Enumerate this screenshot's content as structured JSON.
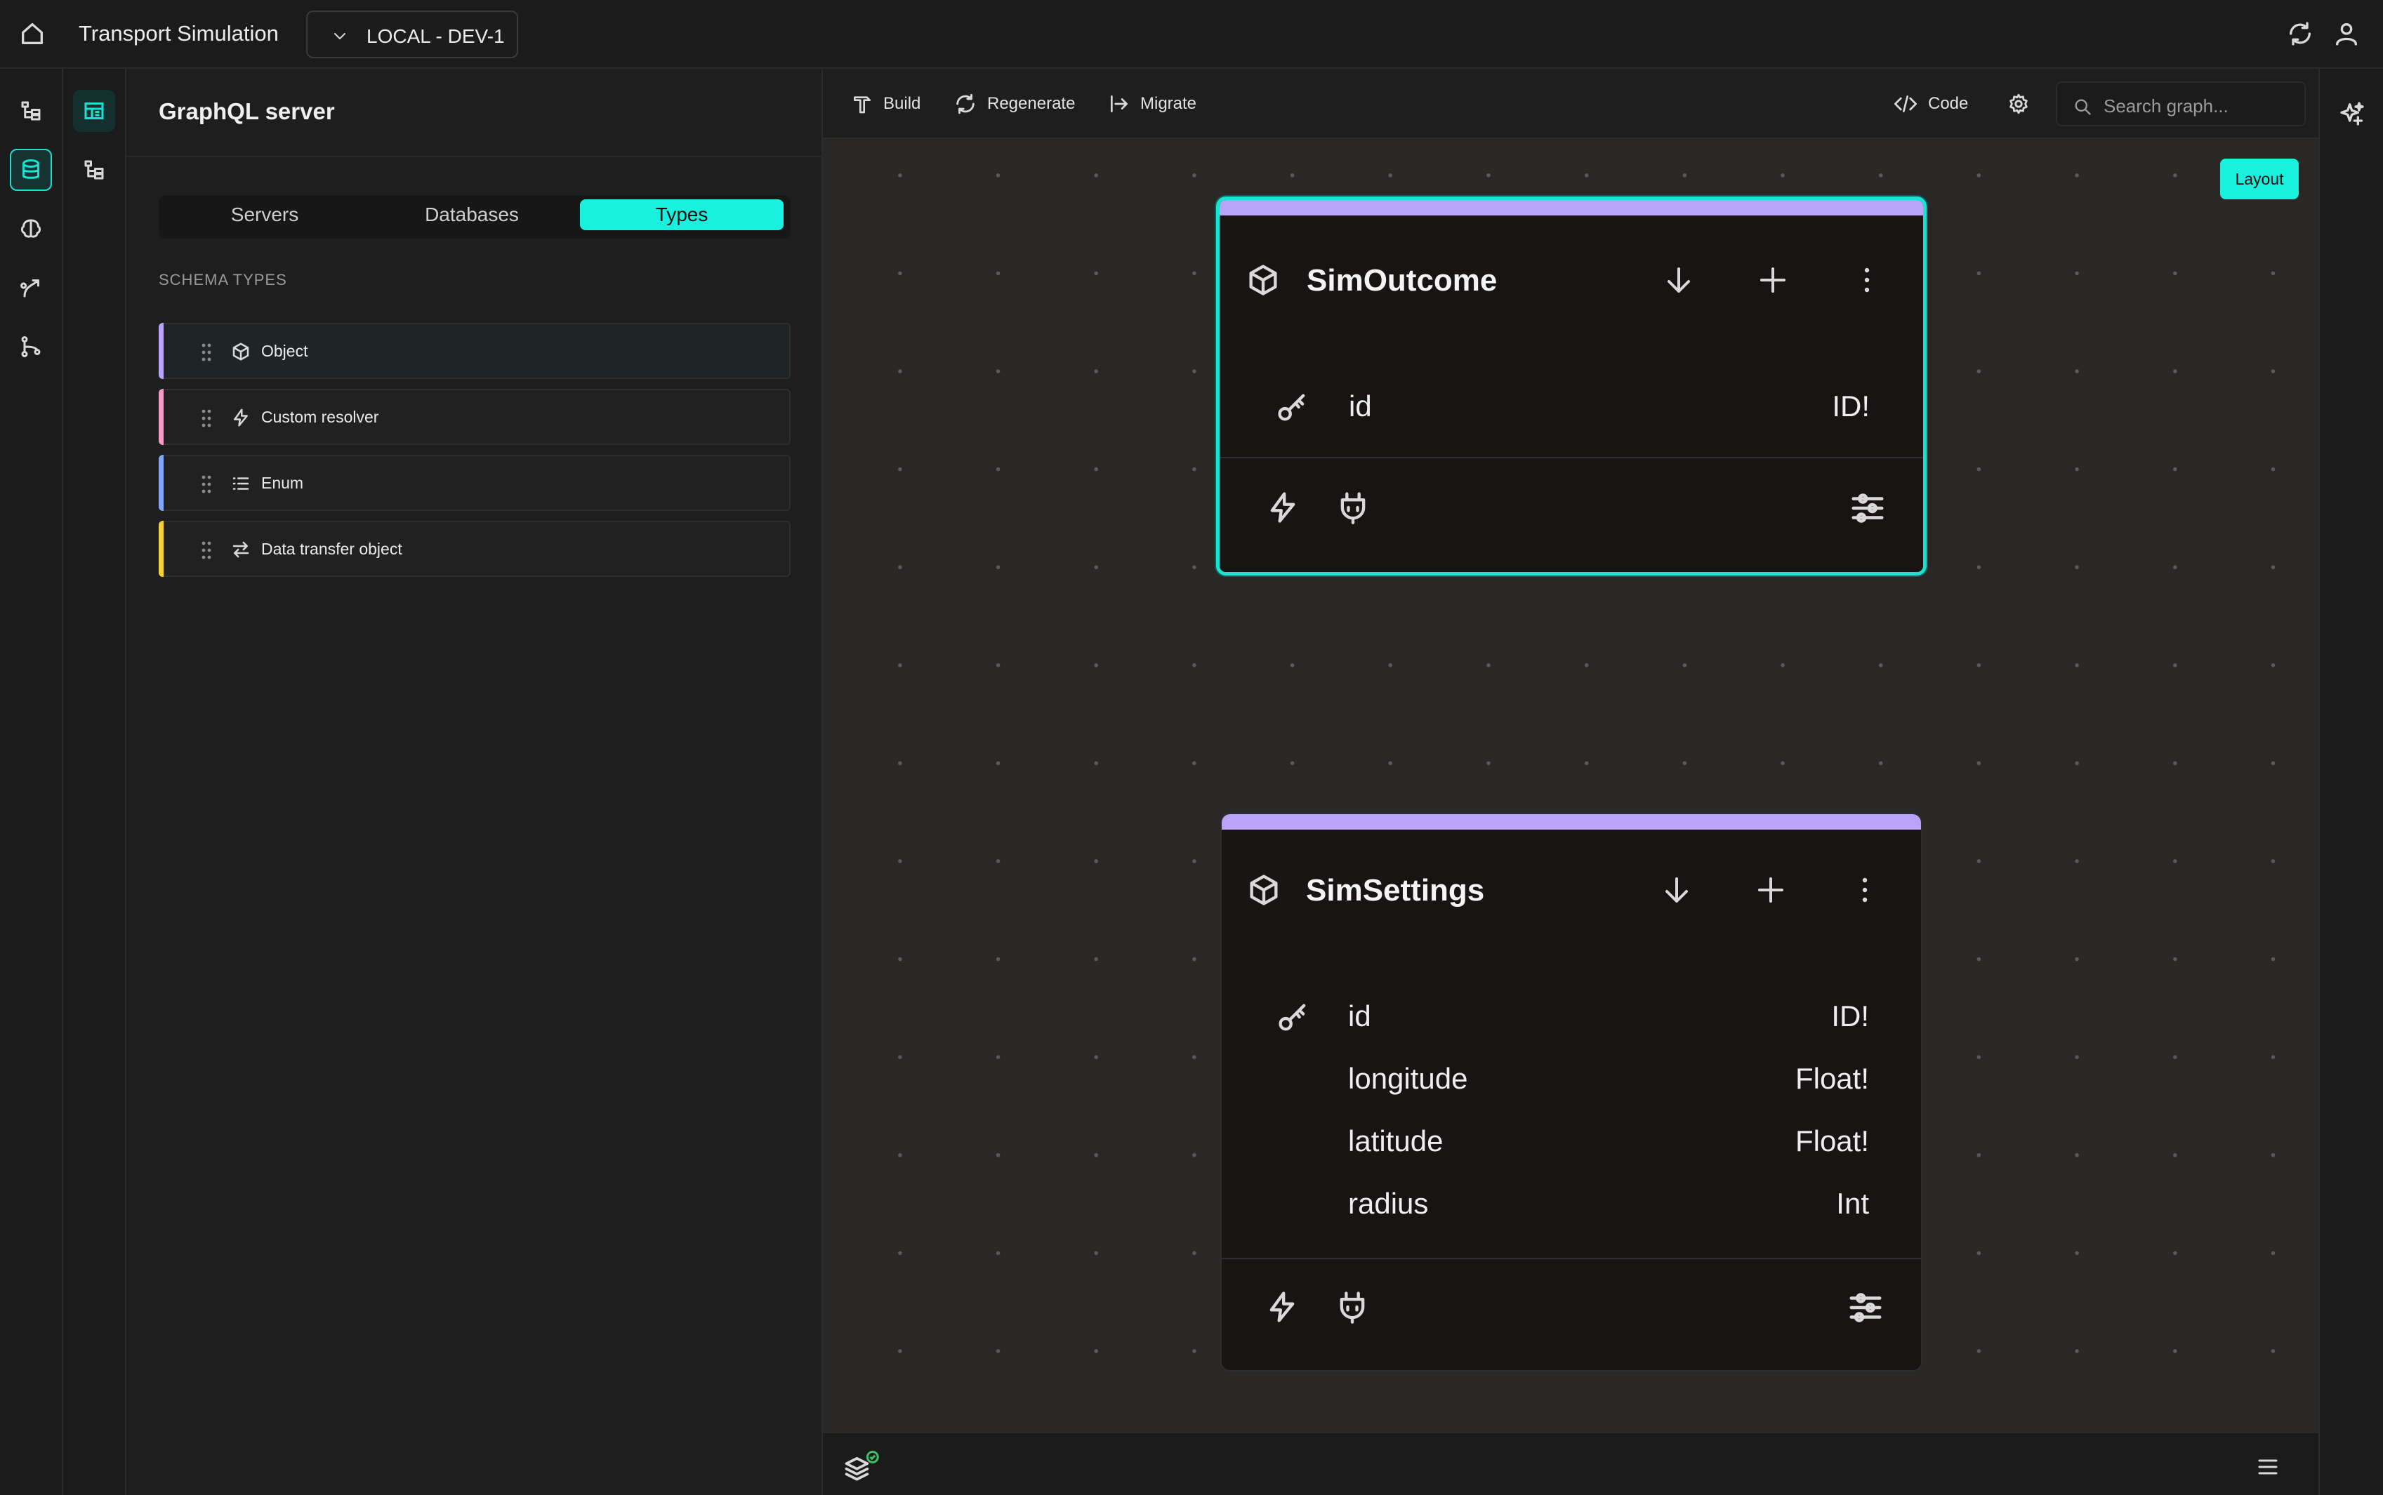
{
  "header": {
    "app_title": "Transport Simulation",
    "environment": "LOCAL - DEV-1"
  },
  "panel": {
    "title": "GraphQL server",
    "tabs": [
      {
        "label": "Servers",
        "active": false
      },
      {
        "label": "Databases",
        "active": false
      },
      {
        "label": "Types",
        "active": true
      }
    ],
    "schema_label": "SCHEMA TYPES",
    "types": [
      {
        "label": "Object",
        "icon": "cube-icon",
        "color": "#b9a4f7"
      },
      {
        "label": "Custom resolver",
        "icon": "lightning-icon",
        "color": "#f29bc8"
      },
      {
        "label": "Enum",
        "icon": "list-icon",
        "color": "#7fa7f2"
      },
      {
        "label": "Data transfer object",
        "icon": "arrows-exchange-icon",
        "color": "#f2d13a"
      }
    ]
  },
  "toolbar": {
    "build": "Build",
    "regenerate": "Regenerate",
    "migrate": "Migrate",
    "code": "Code",
    "search_placeholder": "Search graph..."
  },
  "canvas": {
    "layout_button": "Layout",
    "nodes": [
      {
        "name": "SimOutcome",
        "selected": true,
        "fields": [
          {
            "name": "id",
            "type": "ID!",
            "key": true
          }
        ]
      },
      {
        "name": "SimSettings",
        "selected": false,
        "fields": [
          {
            "name": "id",
            "type": "ID!",
            "key": true
          },
          {
            "name": "longitude",
            "type": "Float!",
            "key": false
          },
          {
            "name": "latitude",
            "type": "Float!",
            "key": false
          },
          {
            "name": "radius",
            "type": "Int",
            "key": false
          }
        ]
      }
    ]
  },
  "colors": {
    "accent": "#19f0de",
    "object_type": "#b9a4f7"
  }
}
